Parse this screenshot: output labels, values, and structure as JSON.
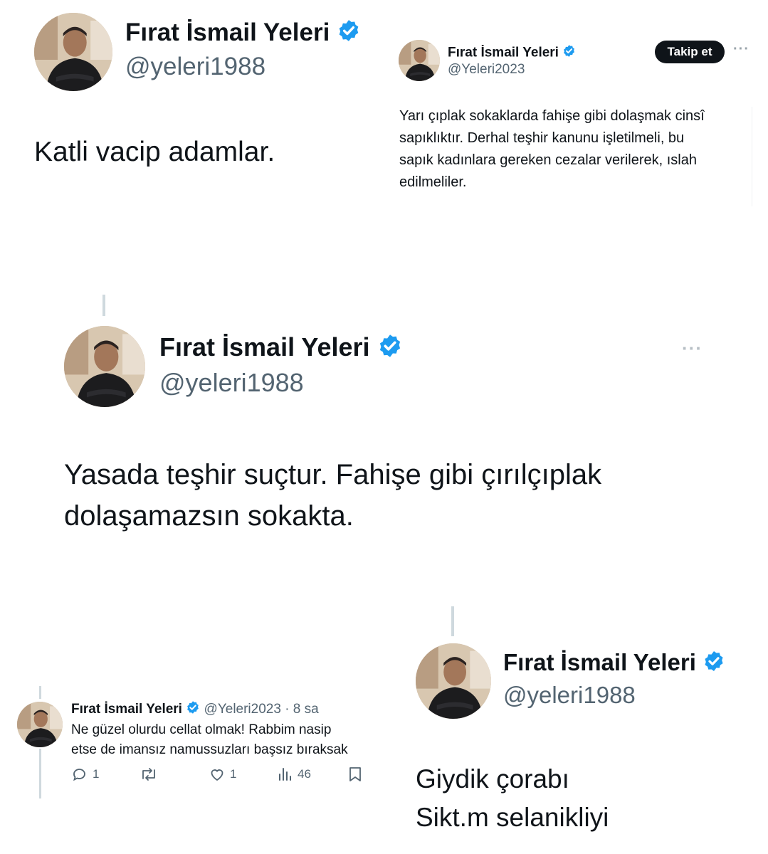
{
  "colors": {
    "verified": "#1d9bf0",
    "text": "#0f1419",
    "muted": "#536471",
    "follow_bg": "#0f1419"
  },
  "post1": {
    "author_name": "Fırat İsmail Yeleri",
    "handle": "@yeleri1988",
    "text": "Katli vacip adamlar."
  },
  "post2": {
    "author_name": "Fırat İsmail Yeleri",
    "handle": "@Yeleri2023",
    "follow_label": "Takip et",
    "more_label": "···",
    "text_lines": [
      "Yarı çıplak sokaklarda fahişe gibi dolaşmak cinsî",
      "sapıklıktır. Derhal teşhir kanunu işletilmeli, bu",
      "sapık kadınlara gereken cezalar verilerek, ıslah",
      "edilmeliler."
    ]
  },
  "post3": {
    "author_name": "Fırat İsmail Yeleri",
    "handle": "@yeleri1988",
    "more_label": "···",
    "text_lines": [
      "Yasada teşhir suçtur. Fahişe gibi çırılçıplak",
      "dolaşamazsın sokakta."
    ]
  },
  "post4": {
    "author_name": "Fırat İsmail Yeleri",
    "handle_time": "@Yeleri2023 · 8 sa",
    "text_lines": [
      "Ne güzel olurdu cellat olmak! Rabbim nasip",
      "etse de imansız namussuzları başsız bıraksak"
    ],
    "actions": {
      "replies": "1",
      "reposts": "",
      "likes": "1",
      "views": "46"
    }
  },
  "post5": {
    "author_name": "Fırat İsmail Yeleri",
    "handle": "@yeleri1988",
    "text_lines": [
      "Giydik çorabı",
      "Sikt.m selanikliyi"
    ]
  }
}
